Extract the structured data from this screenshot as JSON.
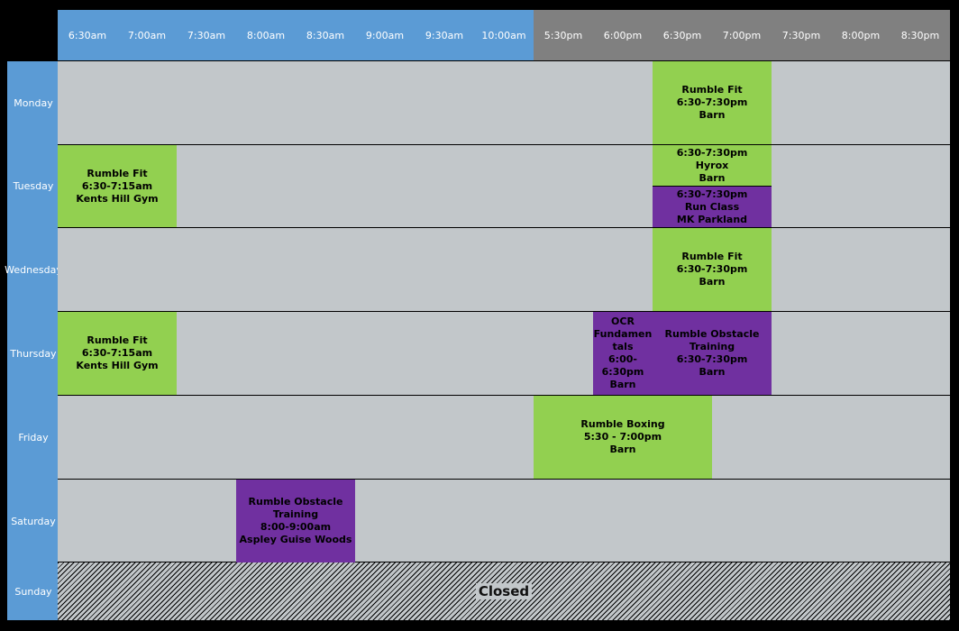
{
  "schedule": {
    "times": [
      "6:30am",
      "7:00am",
      "7:30am",
      "8:00am",
      "8:30am",
      "9:00am",
      "9:30am",
      "10:00am",
      "5:30pm",
      "6:00pm",
      "6:30pm",
      "7:00pm",
      "7:30pm",
      "8:00pm",
      "8:30pm"
    ],
    "days": [
      "Monday",
      "Tuesday",
      "Wednesday",
      "Thursday",
      "Friday",
      "Saturday",
      "Sunday"
    ],
    "closed_label": "Closed",
    "colors": {
      "morning_header": "#5b9bd5",
      "evening_header": "#808080",
      "grid": "#c2c7ca",
      "green": "#92d050",
      "purple": "#7030a0"
    },
    "events": {
      "mon_fit": {
        "lines": [
          "Rumble Fit",
          "6:30-7:30pm",
          "Barn"
        ]
      },
      "tue_fit": {
        "lines": [
          "Rumble Fit",
          "6:30-7:15am",
          "Kents Hill Gym"
        ]
      },
      "tue_hyrox": {
        "lines": [
          "6:30-7:30pm",
          "Hyrox",
          "Barn"
        ]
      },
      "tue_run": {
        "lines": [
          "6:30-7:30pm",
          "Run Class",
          "MK Parkland"
        ]
      },
      "wed_fit": {
        "lines": [
          "Rumble Fit",
          "6:30-7:30pm",
          "Barn"
        ]
      },
      "thu_fit": {
        "lines": [
          "Rumble Fit",
          "6:30-7:15am",
          "Kents Hill Gym"
        ]
      },
      "thu_ocr": {
        "lines": [
          "OCR",
          "Fundamen",
          "tals",
          "6:00-",
          "6:30pm",
          "Barn"
        ]
      },
      "thu_obstacle": {
        "lines": [
          "Rumble Obstacle",
          "Training",
          "6:30-7:30pm",
          "Barn"
        ]
      },
      "fri_boxing": {
        "lines": [
          "Rumble Boxing",
          "5:30 - 7:00pm",
          "Barn"
        ]
      },
      "sat_obstacle": {
        "lines": [
          "Rumble Obstacle",
          "Training",
          "8:00-9:00am",
          "Aspley Guise Woods"
        ]
      }
    }
  }
}
